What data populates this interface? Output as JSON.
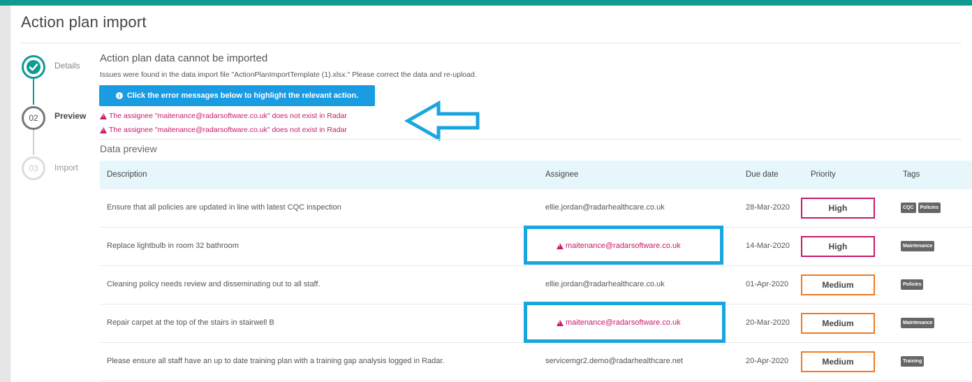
{
  "page_title": "Action plan import",
  "steps": [
    {
      "number": "",
      "label": "Details",
      "state": "done",
      "icon": "check-icon"
    },
    {
      "number": "02",
      "label": "Preview",
      "state": "current"
    },
    {
      "number": "03",
      "label": "Import",
      "state": "future"
    }
  ],
  "preview": {
    "heading": "Action plan data cannot be imported",
    "subtext": "Issues were found in the data import file \"ActionPlanImportTemplate (1).xlsx.\" Please correct the data and re-upload.",
    "info_button": "Click the error messages below to highlight the relevant action.",
    "errors": [
      "The assignee \"maitenance@radarsoftware.co.uk\" does not exist in Radar",
      "The assignee \"maitenance@radarsoftware.co.uk\" does not exist in Radar"
    ],
    "section_title": "Data preview"
  },
  "table": {
    "columns": [
      "Description",
      "Assignee",
      "Due date",
      "Priority",
      "Tags"
    ],
    "rows": [
      {
        "description": "Ensure that all policies are updated in line with latest CQC inspection",
        "assignee": "ellie.jordan@radarhealthcare.co.uk",
        "assignee_error": false,
        "due": "28-Mar-2020",
        "priority": "High",
        "tags": [
          "CQC",
          "Policies"
        ]
      },
      {
        "description": "Replace lightbulb in room 32 bathroom",
        "assignee": "maitenance@radarsoftware.co.uk",
        "assignee_error": true,
        "due": "14-Mar-2020",
        "priority": "High",
        "tags": [
          "Maintenance"
        ]
      },
      {
        "description": "Cleaning policy needs review and disseminating out to all staff.",
        "assignee": "ellie.jordan@radarhealthcare.co.uk",
        "assignee_error": false,
        "due": "01-Apr-2020",
        "priority": "Medium",
        "tags": [
          "Policies"
        ]
      },
      {
        "description": "Repair carpet at the top of the stairs in stairwell B",
        "assignee": "maitenance@radarsoftware.co.uk",
        "assignee_error": true,
        "due": "20-Mar-2020",
        "priority": "Medium",
        "tags": [
          "Maintenance"
        ]
      },
      {
        "description": "Please ensure all staff have an up to date training plan with a training gap analysis logged in Radar.",
        "assignee": "servicemgr2.demo@radarhealthcare.net",
        "assignee_error": false,
        "due": "20-Apr-2020",
        "priority": "Medium",
        "tags": [
          "Training"
        ]
      }
    ]
  },
  "colors": {
    "brand_teal": "#0f9a92",
    "info_blue": "#1a9ce3",
    "error_pink": "#c61a67",
    "priority_high": "#c61a67",
    "priority_medium": "#f07a1e",
    "annotation_blue": "#19a6e0"
  }
}
